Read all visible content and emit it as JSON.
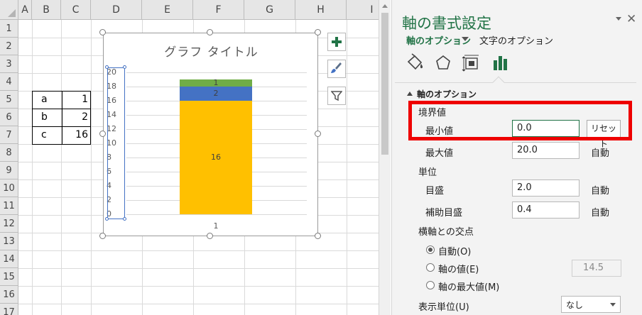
{
  "sheet": {
    "columns": [
      "A",
      "B",
      "C",
      "D",
      "E",
      "F",
      "G",
      "H",
      "I"
    ],
    "rows": [
      "1",
      "2",
      "3",
      "4",
      "5",
      "6",
      "7",
      "8",
      "9",
      "10",
      "11",
      "12",
      "13",
      "14",
      "15",
      "16",
      "17"
    ],
    "table": [
      {
        "key": "a",
        "value": "1"
      },
      {
        "key": "b",
        "value": "2"
      },
      {
        "key": "c",
        "value": "16"
      }
    ]
  },
  "chart": {
    "title": "グラフ タイトル",
    "icons": [
      "plus-icon",
      "brush-icon",
      "filter-icon"
    ]
  },
  "chart_data": {
    "type": "bar",
    "stacked": true,
    "title": "グラフ タイトル",
    "categories": [
      "1"
    ],
    "series": [
      {
        "values": [
          16
        ],
        "color": "#ffc000"
      },
      {
        "values": [
          2
        ],
        "color": "#4472c4"
      },
      {
        "values": [
          1
        ],
        "color": "#70ad47"
      }
    ],
    "yticks": [
      "0",
      "2",
      "4",
      "6",
      "8",
      "10",
      "12",
      "14",
      "16",
      "18",
      "20"
    ],
    "ylim": [
      0,
      20
    ],
    "grid": true,
    "data_labels": [
      "16",
      "2",
      "1"
    ]
  },
  "pane": {
    "title": "軸の書式設定",
    "tab_axis_options": "軸のオプション",
    "tab_text_options": "文字のオプション",
    "icons": [
      "fill-bucket-icon",
      "pentagon-icon",
      "size-properties-icon",
      "bar-chart-icon"
    ],
    "section_title": "軸のオプション",
    "bounds_label": "境界値",
    "min_label": "最小値",
    "min_value": "0.0",
    "reset_label": "リセット",
    "max_label": "最大値",
    "max_value": "20.0",
    "auto_label": "自動",
    "units_label": "単位",
    "major_label": "目盛",
    "major_value": "2.0",
    "minor_label": "補助目盛",
    "minor_value": "0.4",
    "cross_label": "横軸との交点",
    "cross_auto": "自動(O)",
    "cross_value": "軸の値(E)",
    "cross_value_input": "14.5",
    "cross_max": "軸の最大値(M)",
    "display_units_label": "表示単位(U)",
    "display_units_value": "なし",
    "accent": "#217346",
    "highlight": "#ee0000"
  }
}
